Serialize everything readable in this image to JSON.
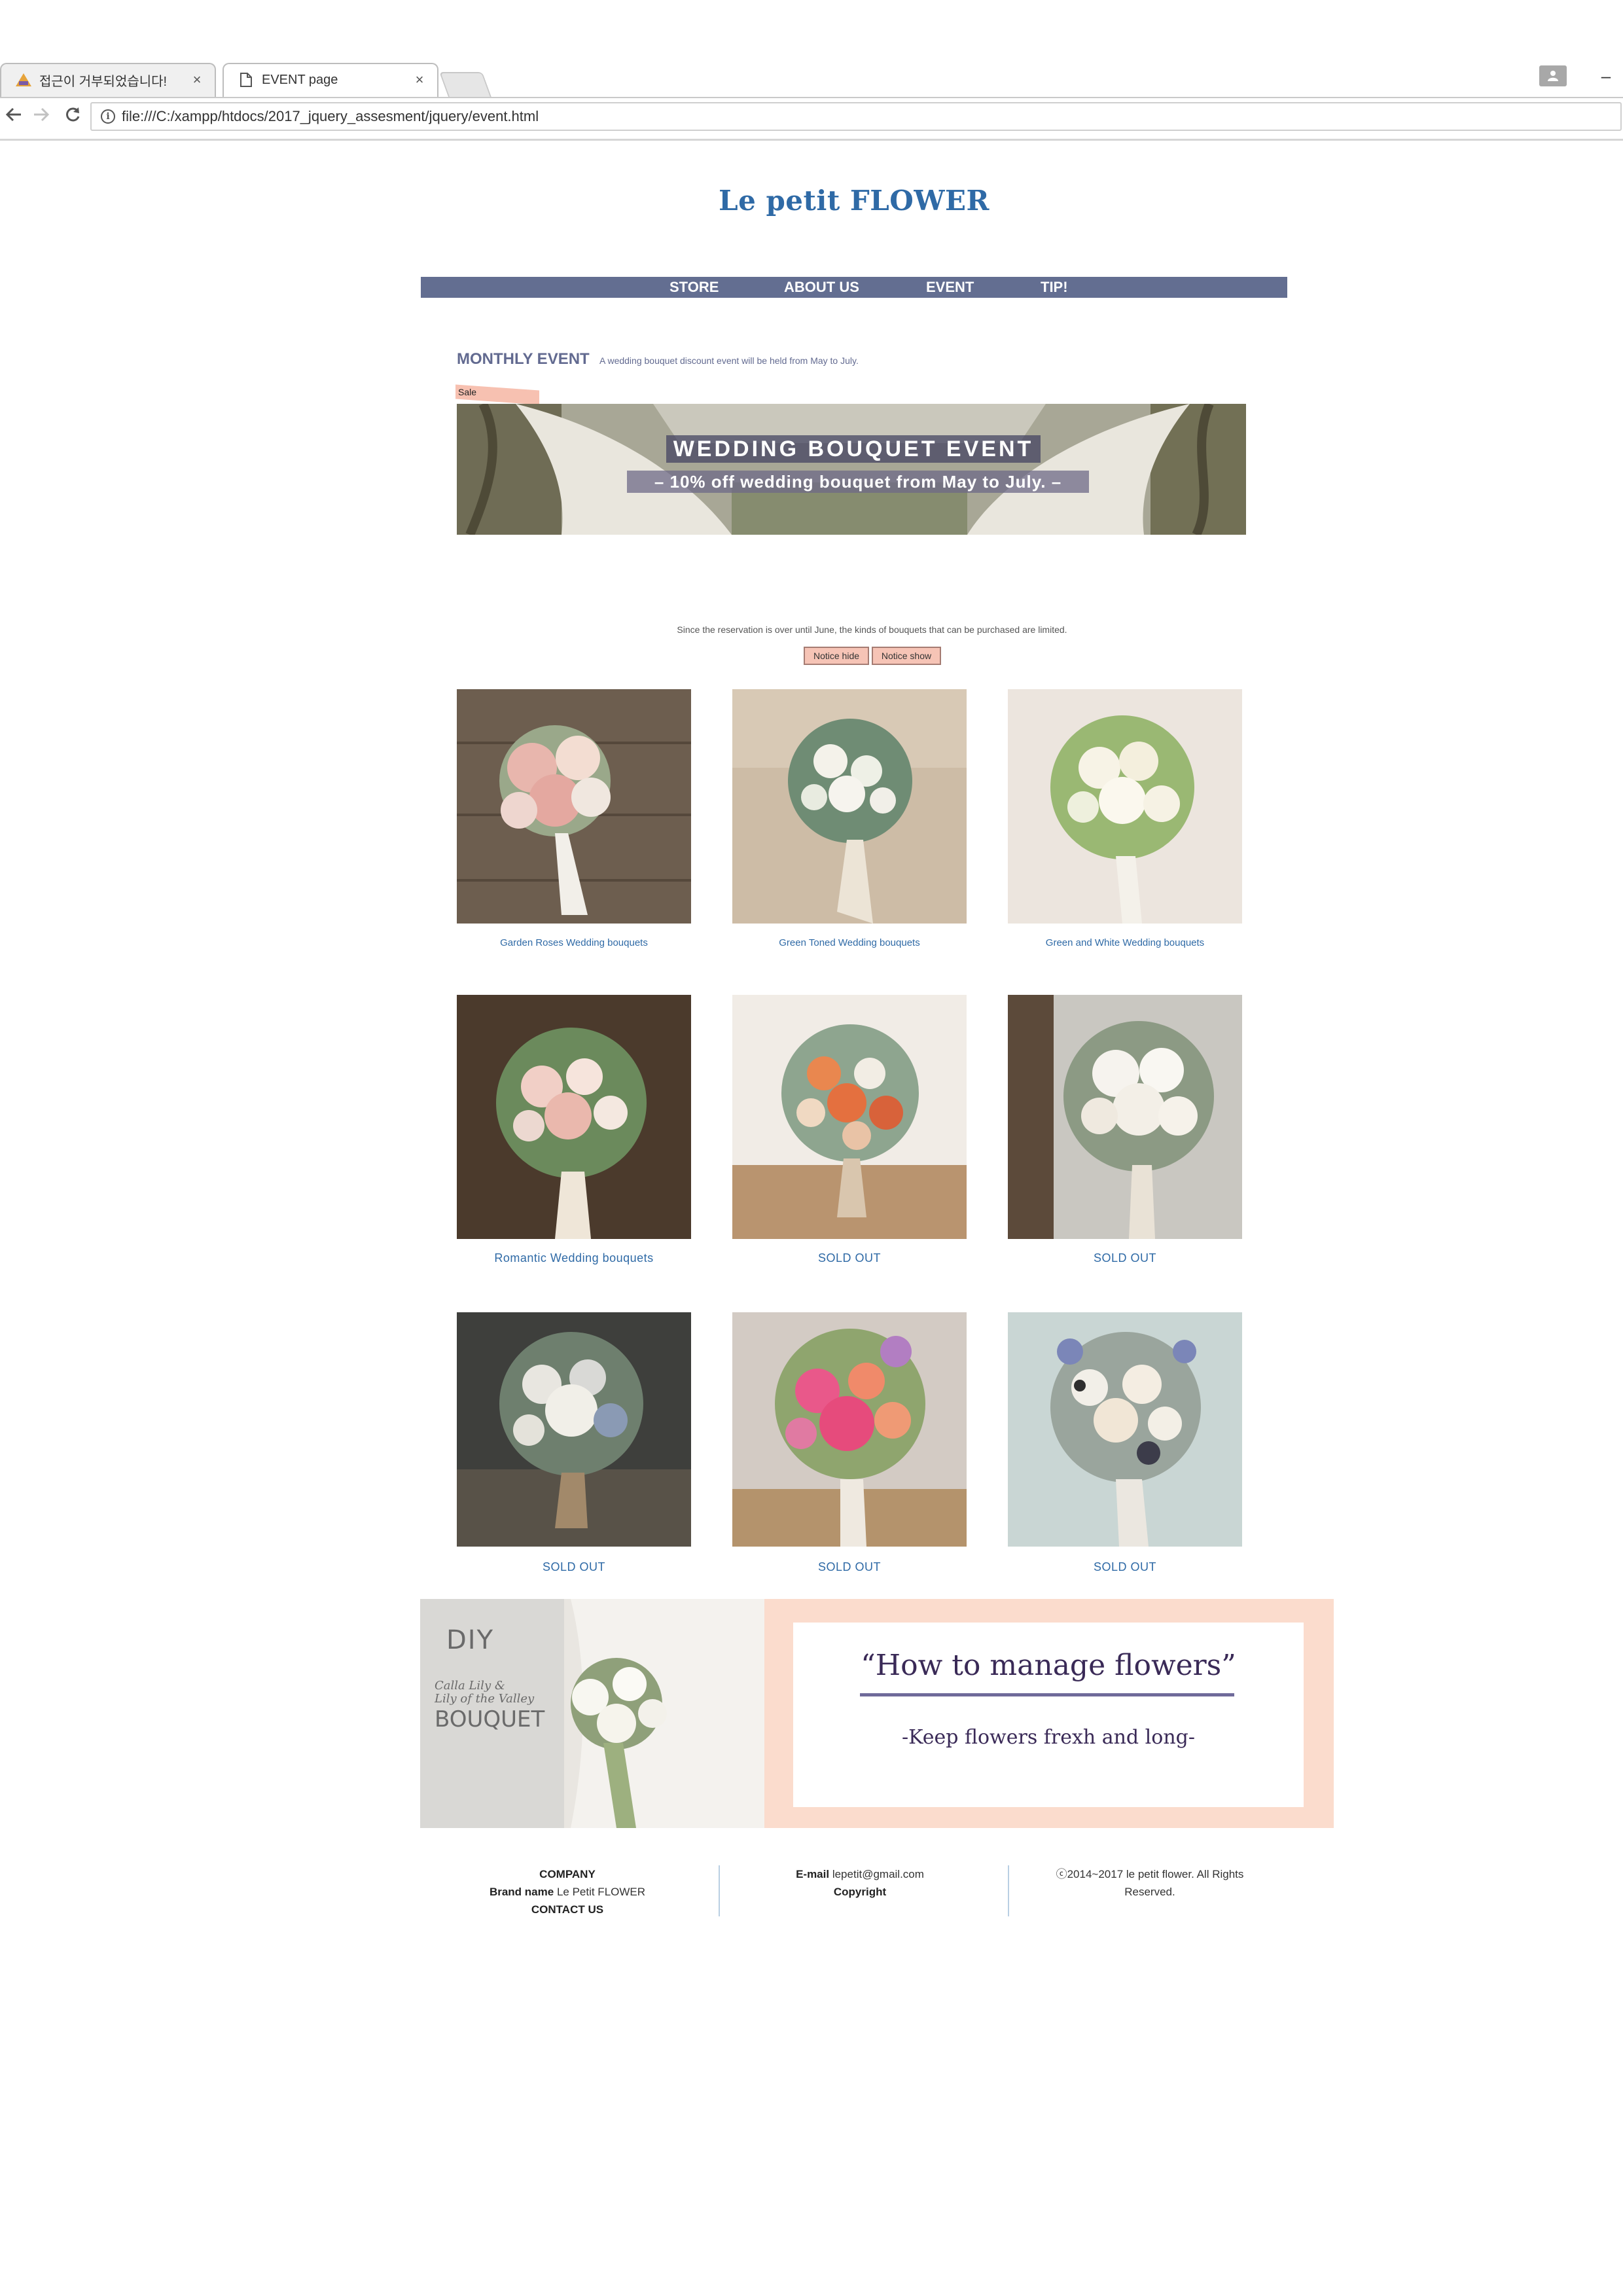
{
  "browser": {
    "tabs": [
      {
        "title": "접근이 거부되었습니다!",
        "close": "×",
        "active": false
      },
      {
        "title": "EVENT page",
        "close": "×",
        "active": true
      }
    ],
    "url": "file:///C:/xampp/htdocs/2017_jquery_assesment/jquery/event.html",
    "minimize": "–"
  },
  "site": {
    "title": "Le petit FLOWER",
    "nav": [
      "STORE",
      "ABOUT US",
      "EVENT",
      "TIP!"
    ]
  },
  "event": {
    "heading": "MONTHLY EVENT",
    "description": "A wedding bouquet discount event will be held from May to July.",
    "sale_tag": "Sale",
    "banner_title": "WEDDING BOUQUET EVENT",
    "banner_subtitle": "– 10% off wedding bouquet from May to July. –"
  },
  "notice": {
    "text": "Since the reservation is over until June, the kinds of bouquets that can be purchased are limited.",
    "hide_button": "Notice hide",
    "show_button": "Notice show"
  },
  "products": [
    {
      "caption": "Garden Roses Wedding bouquets"
    },
    {
      "caption": "Green Toned Wedding bouquets"
    },
    {
      "caption": "Green and White Wedding bouquets"
    },
    {
      "caption": "Romantic Wedding bouquets"
    },
    {
      "caption": "SOLD OUT"
    },
    {
      "caption": "SOLD OUT"
    },
    {
      "caption": "SOLD OUT"
    },
    {
      "caption": "SOLD OUT"
    },
    {
      "caption": "SOLD OUT"
    }
  ],
  "diy": {
    "logo_line1": "DIY",
    "logo_line2": "Calla Lily &",
    "logo_line3": "Lily of the Valley",
    "logo_line4": "BOUQUET",
    "title": "“How to manage flowers”",
    "subtitle": "-Keep flowers frexh and long-"
  },
  "footer": {
    "company_label": "COMPANY",
    "brand_label": "Brand name",
    "brand_value": "Le Petit FLOWER",
    "contact_label": "CONTACT US",
    "email_label": "E-mail",
    "email_value": "lepetit@gmail.com",
    "copyright_label": "Copyright",
    "copyright_text": "ⓒ2014~2017 le petit flower. All Rights Reserved."
  },
  "colors": {
    "nav_bar": "#636e91",
    "title_blue": "#2f6aa6",
    "banner_pink": "#fbdccd",
    "button_pink": "#f6c4b6"
  }
}
